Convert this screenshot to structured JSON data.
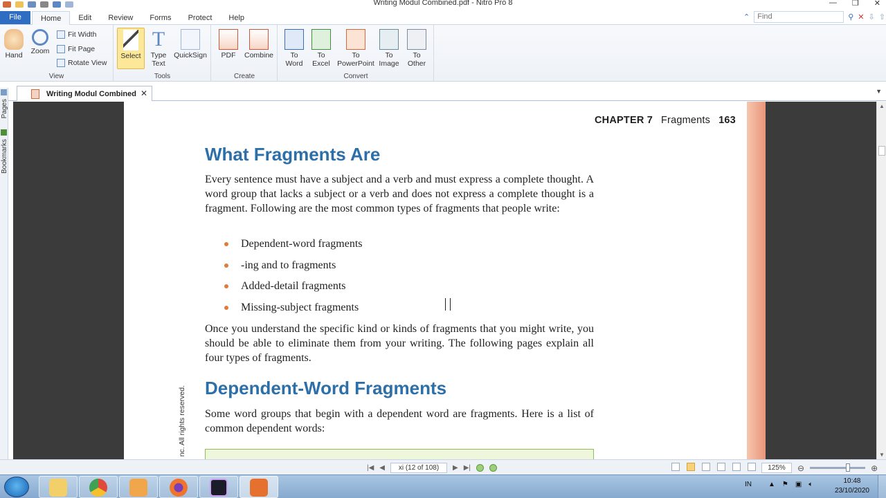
{
  "window": {
    "title": "Writing Modul Combined.pdf - Nitro Pro 8"
  },
  "ribbon_tabs": [
    "Home",
    "Edit",
    "Review",
    "Forms",
    "Protect",
    "Help"
  ],
  "file_tab": "File",
  "find": {
    "placeholder": "Find"
  },
  "groups": {
    "view": {
      "name": "View",
      "hand": "Hand",
      "zoom": "Zoom",
      "fit_width": "Fit Width",
      "fit_page": "Fit Page",
      "rotate_view": "Rotate View"
    },
    "tools": {
      "name": "Tools",
      "select": "Select",
      "type_text_1": "Type",
      "type_text_2": "Text",
      "quicksign": "QuickSign"
    },
    "create": {
      "name": "Create",
      "pdf": "PDF",
      "combine": "Combine"
    },
    "convert": {
      "name": "Convert",
      "to_word_1": "To",
      "to_word_2": "Word",
      "to_excel_1": "To",
      "to_excel_2": "Excel",
      "to_ppt_1": "To",
      "to_ppt_2": "PowerPoint",
      "to_image_1": "To",
      "to_image_2": "Image",
      "to_other_1": "To",
      "to_other_2": "Other"
    }
  },
  "doc_tab": {
    "name": "Writing Modul Combined",
    "close": "✕"
  },
  "side_panel": {
    "pages": "Pages",
    "bookmarks": "Bookmarks"
  },
  "document": {
    "header_chapter": "CHAPTER 7",
    "header_section": "Fragments",
    "header_page": "163",
    "h1_a": "What Fragments Are",
    "para_1": "Every sentence must have a subject and a verb and must express a complete thought. A word group that lacks a subject or a verb and does not express a complete thought is a fragment. Following are the most common types of fragments that people write:",
    "bullets": [
      "Dependent-word fragments",
      "-ing and to fragments",
      "Added-detail fragments",
      "Missing-subject fragments"
    ],
    "para_2": "Once you understand the specific kind or kinds of fragments that you might write, you should be able to eliminate them from your writing. The following pages explain all four types of fragments.",
    "h1_b": "Dependent-Word Fragments",
    "para_3": "Some word groups that begin with a dependent word are fragments. Here is a list of common dependent words:",
    "copyright": "nc. All rights reserved."
  },
  "status": {
    "page_indicator": "xi (12 of 108)",
    "zoom": "125%"
  },
  "taskbar": {
    "lang": "IN",
    "time": "10:48",
    "date": "23/10/2020"
  }
}
